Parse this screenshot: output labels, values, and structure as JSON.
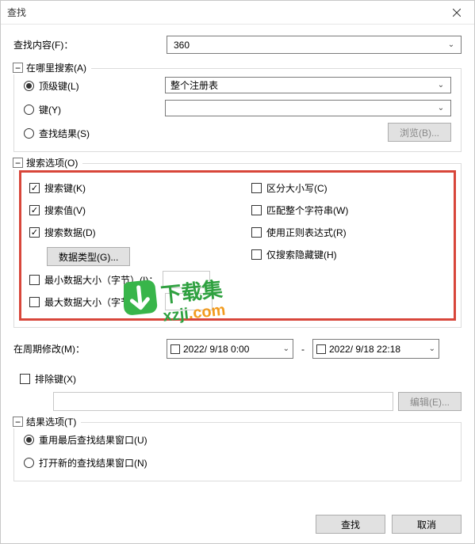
{
  "window": {
    "title": "查找"
  },
  "search_content": {
    "label": "查找内容(F)：",
    "value": "360"
  },
  "where": {
    "legend": "在哪里搜索(A)",
    "top_key": "顶级键(L)",
    "key": "键(Y)",
    "search_results": "查找结果(S)",
    "scope_selected": "整个注册表",
    "browse": "浏览(B)..."
  },
  "options": {
    "legend": "搜索选项(O)",
    "search_keys": "搜索键(K)",
    "search_values": "搜索值(V)",
    "search_data": "搜索数据(D)",
    "data_type": "数据类型(G)...",
    "case_sensitive": "区分大小写(C)",
    "whole_string": "匹配整个字符串(W)",
    "regex": "使用正则表达式(R)",
    "hidden_keys": "仅搜索隐藏键(H)",
    "min_size": "最小数据大小（字节）(I)：",
    "max_size": "最大数据大小（字节）(J)："
  },
  "period": {
    "label": "在周期修改(M)：",
    "from": "2022/ 9/18  0:00",
    "to": "2022/ 9/18 22:18"
  },
  "exclude": {
    "label": "排除键(X)",
    "edit": "编辑(E)..."
  },
  "results": {
    "legend": "结果选项(T)",
    "reuse": "重用最后查找结果窗口(U)",
    "new_window": "打开新的查找结果窗口(N)"
  },
  "footer": {
    "find": "查找",
    "cancel": "取消"
  },
  "watermark": {
    "brand": "下载集",
    "domain1": "xzji",
    "domain2": ".com"
  }
}
